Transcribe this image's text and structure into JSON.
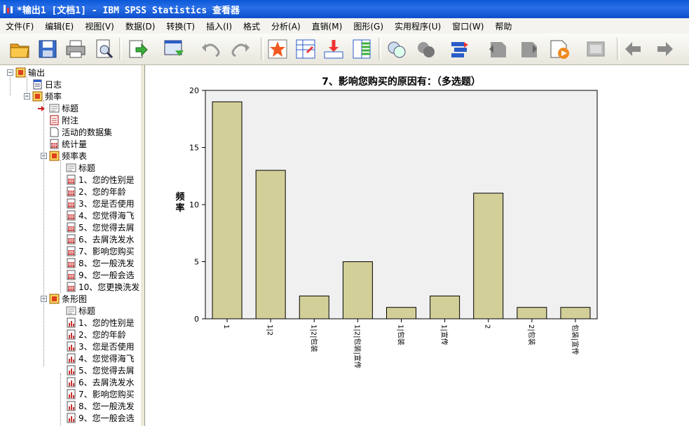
{
  "window": {
    "title": "*输出1 [文档1] - IBM SPSS Statistics 查看器"
  },
  "menu": [
    "文件(F)",
    "编辑(E)",
    "视图(V)",
    "数据(D)",
    "转换(T)",
    "插入(I)",
    "格式",
    "分析(A)",
    "直销(M)",
    "图形(G)",
    "实用程序(U)",
    "窗口(W)",
    "帮助"
  ],
  "toolbar": [
    {
      "name": "open-icon"
    },
    {
      "name": "save-icon"
    },
    {
      "name": "print-icon"
    },
    {
      "name": "print-preview-icon"
    },
    {
      "name": "export-icon"
    },
    {
      "name": "recall-dialog-icon"
    },
    {
      "name": "undo-icon"
    },
    {
      "name": "redo-icon"
    },
    {
      "name": "goto-data-icon"
    },
    {
      "name": "goto-case-icon"
    },
    {
      "name": "goto-variable-icon"
    },
    {
      "name": "variables-icon"
    },
    {
      "name": "show-all-icon"
    },
    {
      "name": "hide-icon"
    },
    {
      "name": "designate-window-icon"
    },
    {
      "name": "promote-icon"
    },
    {
      "name": "demote-icon"
    },
    {
      "name": "run-script-icon"
    },
    {
      "name": "collapse-icon"
    },
    {
      "name": "back-icon"
    },
    {
      "name": "forward-icon"
    }
  ],
  "tree": [
    {
      "label": "输出",
      "level": 0,
      "expander": "−",
      "icon": "output"
    },
    {
      "label": "日志",
      "level": 1,
      "expander": "",
      "icon": "log"
    },
    {
      "label": "频率",
      "level": 1,
      "expander": "−",
      "icon": "output"
    },
    {
      "label": "标题",
      "level": 2,
      "expander": "",
      "icon": "title",
      "selected": true
    },
    {
      "label": "附注",
      "level": 2,
      "expander": "",
      "icon": "notes"
    },
    {
      "label": "活动的数据集",
      "level": 2,
      "expander": "",
      "icon": "doc"
    },
    {
      "label": "统计量",
      "level": 2,
      "expander": "",
      "icon": "table"
    },
    {
      "label": "频率表",
      "level": 2,
      "expander": "−",
      "icon": "output"
    },
    {
      "label": "标题",
      "level": 3,
      "expander": "",
      "icon": "title"
    },
    {
      "label": "1、您的性别是",
      "level": 3,
      "expander": "",
      "icon": "table"
    },
    {
      "label": "2、您的年龄",
      "level": 3,
      "expander": "",
      "icon": "table"
    },
    {
      "label": "3、您是否使用",
      "level": 3,
      "expander": "",
      "icon": "table"
    },
    {
      "label": "4、您觉得海飞",
      "level": 3,
      "expander": "",
      "icon": "table"
    },
    {
      "label": "5、您觉得去屑",
      "level": 3,
      "expander": "",
      "icon": "table"
    },
    {
      "label": "6、去屑洗发水",
      "level": 3,
      "expander": "",
      "icon": "table"
    },
    {
      "label": "7、影响您购买",
      "level": 3,
      "expander": "",
      "icon": "table"
    },
    {
      "label": "8、您一般洗发",
      "level": 3,
      "expander": "",
      "icon": "table"
    },
    {
      "label": "9、您一般会选",
      "level": 3,
      "expander": "",
      "icon": "table"
    },
    {
      "label": "10、您更换洗发",
      "level": 3,
      "expander": "",
      "icon": "table"
    },
    {
      "label": "条形图",
      "level": 2,
      "expander": "−",
      "icon": "output"
    },
    {
      "label": "标题",
      "level": 3,
      "expander": "",
      "icon": "title"
    },
    {
      "label": "1、您的性别是",
      "level": 3,
      "expander": "",
      "icon": "chart"
    },
    {
      "label": "2、您的年龄",
      "level": 3,
      "expander": "",
      "icon": "chart"
    },
    {
      "label": "3、您是否使用",
      "level": 3,
      "expander": "",
      "icon": "chart"
    },
    {
      "label": "4、您觉得海飞",
      "level": 3,
      "expander": "",
      "icon": "chart"
    },
    {
      "label": "5、您觉得去屑",
      "level": 3,
      "expander": "",
      "icon": "chart"
    },
    {
      "label": "6、去屑洗发水",
      "level": 3,
      "expander": "",
      "icon": "chart"
    },
    {
      "label": "7、影响您购买",
      "level": 3,
      "expander": "",
      "icon": "chart"
    },
    {
      "label": "8、您一般洗发",
      "level": 3,
      "expander": "",
      "icon": "chart"
    },
    {
      "label": "9、您一般会选",
      "level": 3,
      "expander": "",
      "icon": "chart"
    }
  ],
  "colors": {
    "bar_fill": "#d3cf98",
    "bar_stroke": "#000000",
    "plot_bg": "#f0f0f0",
    "title_bar": "#0a58d8"
  },
  "chart_data": {
    "type": "bar",
    "title": "7、影响您购买的原因有：（多选题）",
    "ylabel": "频率",
    "xlabel": "",
    "ylim": [
      0,
      20
    ],
    "yticks": [
      0,
      5,
      10,
      15,
      20
    ],
    "grid": false,
    "categories": [
      [
        "1"
      ],
      [
        "1|2"
      ],
      [
        "1|2|",
        "包装"
      ],
      [
        "1|2|",
        "包装|",
        "宣传"
      ],
      [
        "1|",
        "包装"
      ],
      [
        "1|",
        "宣传"
      ],
      [
        "2"
      ],
      [
        "2|",
        "包装"
      ],
      [
        "包装|",
        "宣传"
      ]
    ],
    "values": [
      19,
      13,
      2,
      5,
      1,
      2,
      11,
      1,
      1
    ]
  }
}
